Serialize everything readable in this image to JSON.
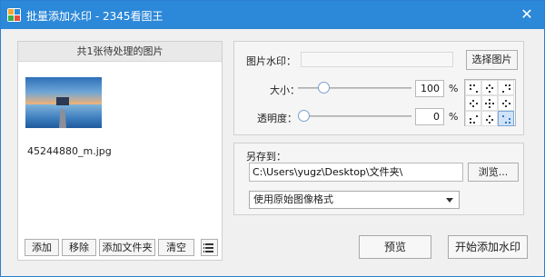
{
  "window": {
    "title": "批量添加水印 - 2345看图王",
    "close_glyph": "✕"
  },
  "file_list": {
    "header": "共1张待处理的图片",
    "files": [
      {
        "name": "45244880_m.jpg"
      }
    ]
  },
  "file_buttons": {
    "add": "添加",
    "remove": "移除",
    "add_folder": "添加文件夹",
    "clear": "清空"
  },
  "watermark": {
    "image_label": "图片水印：",
    "image_path": "",
    "choose_button": "选择图片",
    "size_label": "大小：",
    "size_value": "100",
    "size_level": 0.2,
    "size_unit": "%",
    "opacity_label": "透明度：",
    "opacity_value": "0",
    "opacity_level": 0,
    "opacity_unit": "%",
    "position_selected": "bottom-right"
  },
  "save": {
    "label": "另存到：",
    "path": "C:\\Users\\yugz\\Desktop\\文件夹\\",
    "browse_button": "浏览...",
    "format_selected": "使用原始图像格式"
  },
  "actions": {
    "preview": "预览",
    "start": "开始添加水印"
  },
  "colors": {
    "titlebar": "#2c88d8",
    "selected_position": "#cfe2f7"
  }
}
